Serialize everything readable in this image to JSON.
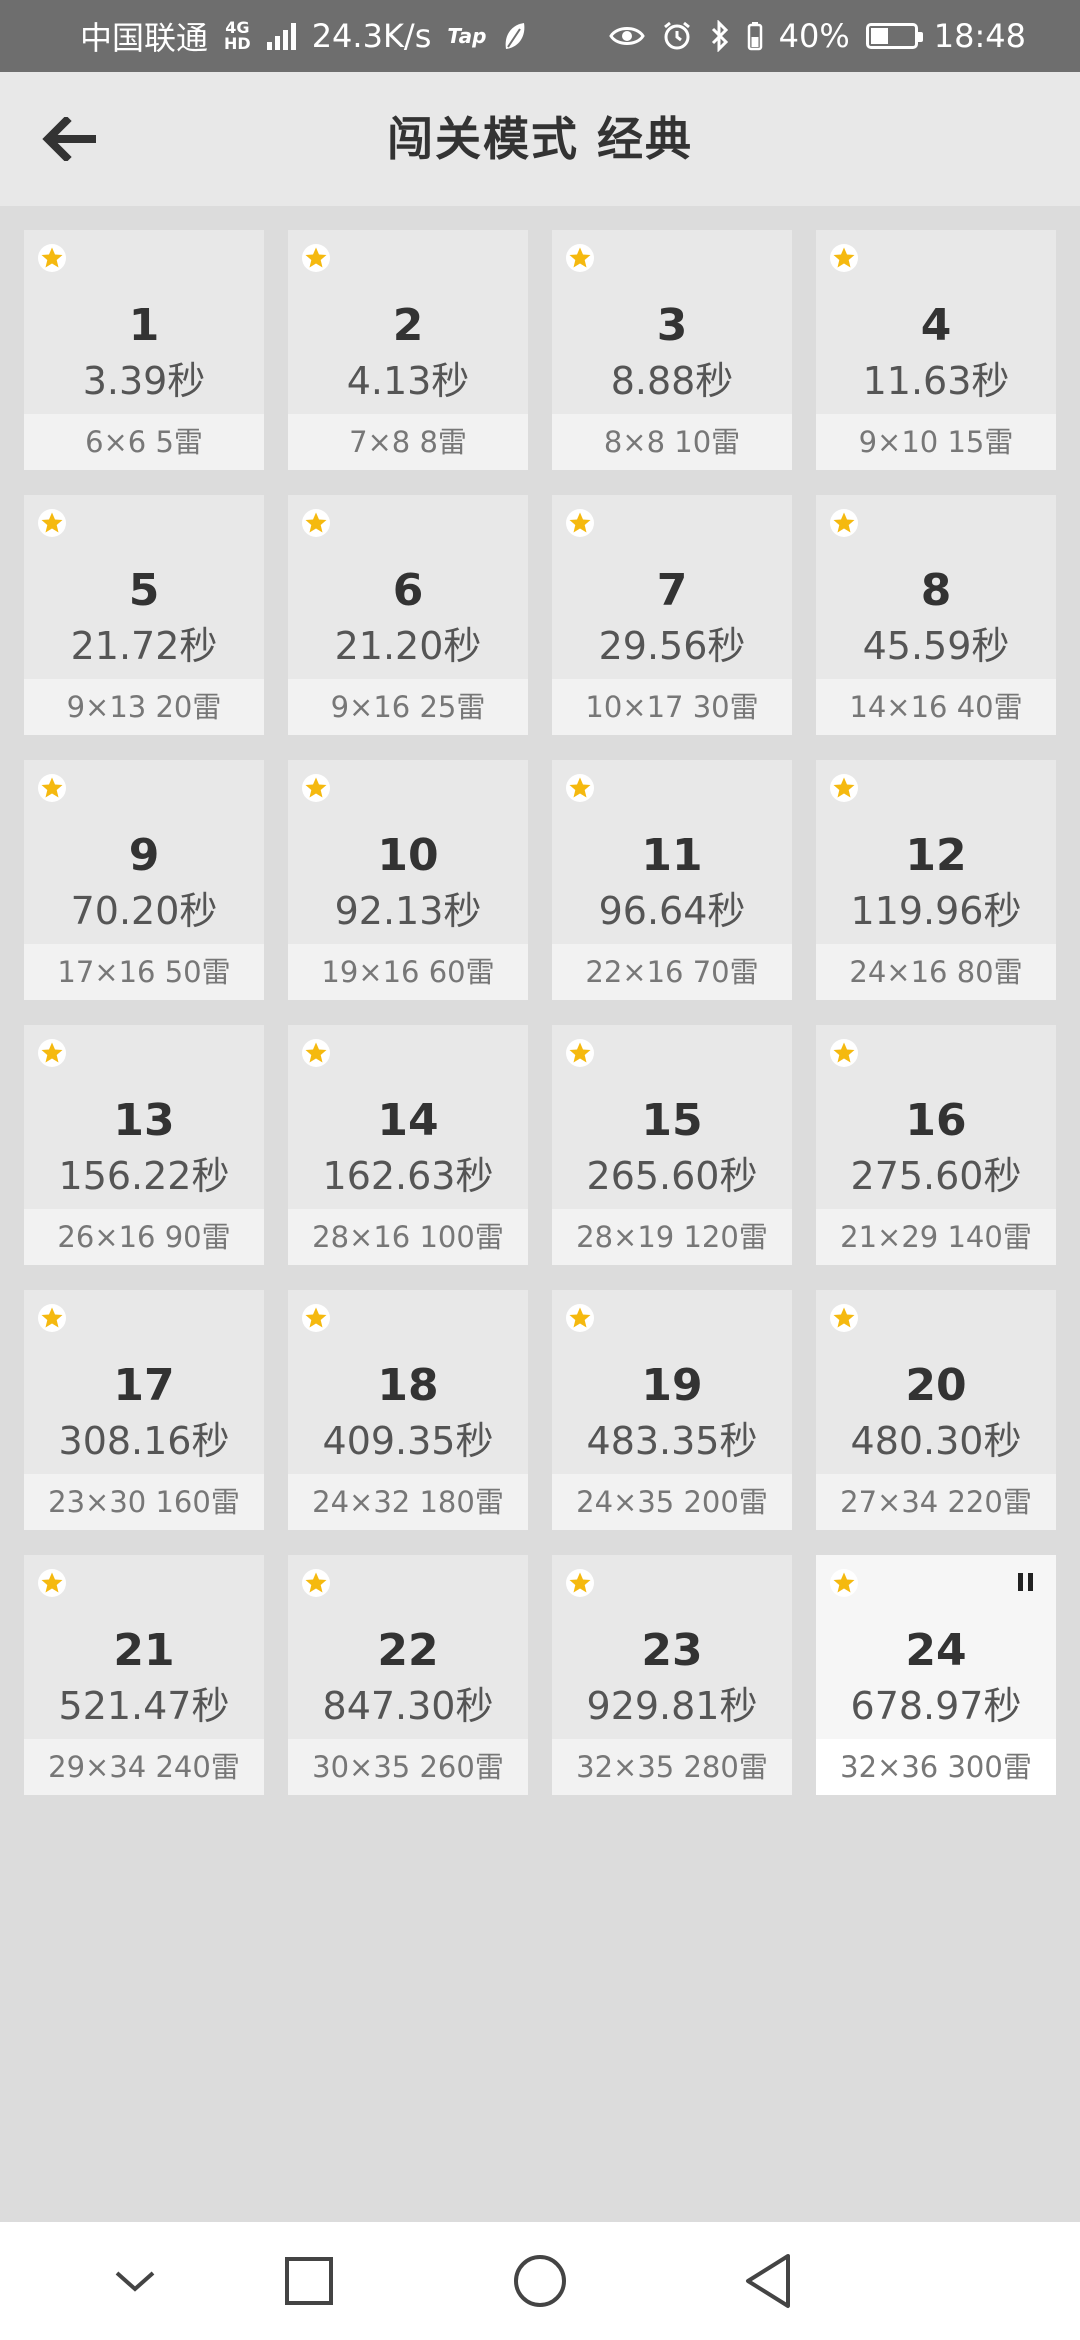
{
  "status_bar": {
    "carrier": "中国联通",
    "network_type": "4G",
    "network_sub": "HD",
    "speed": "24.3K/s",
    "tap_label": "Tap",
    "battery_percent": "40%",
    "battery_level": 0.4,
    "time": "18:48"
  },
  "header": {
    "title": "闯关模式 经典"
  },
  "colors": {
    "star": "#f5b90f",
    "card": "#e8e8e8",
    "background": "#dcdcdc"
  },
  "levels": [
    {
      "number": "1",
      "time": "3.39秒",
      "info": "6×6  5雷",
      "starred": true
    },
    {
      "number": "2",
      "time": "4.13秒",
      "info": "7×8  8雷",
      "starred": true
    },
    {
      "number": "3",
      "time": "8.88秒",
      "info": "8×8  10雷",
      "starred": true
    },
    {
      "number": "4",
      "time": "11.63秒",
      "info": "9×10  15雷",
      "starred": true
    },
    {
      "number": "5",
      "time": "21.72秒",
      "info": "9×13  20雷",
      "starred": true
    },
    {
      "number": "6",
      "time": "21.20秒",
      "info": "9×16  25雷",
      "starred": true
    },
    {
      "number": "7",
      "time": "29.56秒",
      "info": "10×17  30雷",
      "starred": true
    },
    {
      "number": "8",
      "time": "45.59秒",
      "info": "14×16  40雷",
      "starred": true
    },
    {
      "number": "9",
      "time": "70.20秒",
      "info": "17×16  50雷",
      "starred": true
    },
    {
      "number": "10",
      "time": "92.13秒",
      "info": "19×16  60雷",
      "starred": true
    },
    {
      "number": "11",
      "time": "96.64秒",
      "info": "22×16  70雷",
      "starred": true
    },
    {
      "number": "12",
      "time": "119.96秒",
      "info": "24×16  80雷",
      "starred": true
    },
    {
      "number": "13",
      "time": "156.22秒",
      "info": "26×16  90雷",
      "starred": true
    },
    {
      "number": "14",
      "time": "162.63秒",
      "info": "28×16  100雷",
      "starred": true
    },
    {
      "number": "15",
      "time": "265.60秒",
      "info": "28×19  120雷",
      "starred": true
    },
    {
      "number": "16",
      "time": "275.60秒",
      "info": "21×29  140雷",
      "starred": true
    },
    {
      "number": "17",
      "time": "308.16秒",
      "info": "23×30  160雷",
      "starred": true
    },
    {
      "number": "18",
      "time": "409.35秒",
      "info": "24×32  180雷",
      "starred": true
    },
    {
      "number": "19",
      "time": "483.35秒",
      "info": "24×35  200雷",
      "starred": true
    },
    {
      "number": "20",
      "time": "480.30秒",
      "info": "27×34  220雷",
      "starred": true
    },
    {
      "number": "21",
      "time": "521.47秒",
      "info": "29×34  240雷",
      "starred": true
    },
    {
      "number": "22",
      "time": "847.30秒",
      "info": "30×35  260雷",
      "starred": true
    },
    {
      "number": "23",
      "time": "929.81秒",
      "info": "32×35  280雷",
      "starred": true
    },
    {
      "number": "24",
      "time": "678.97秒",
      "info": "32×36  300雷",
      "starred": true,
      "current": true,
      "paused": true
    }
  ]
}
